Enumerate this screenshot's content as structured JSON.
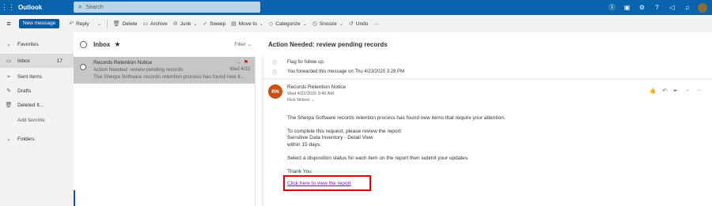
{
  "topbar": {
    "app_name": "Outlook",
    "search_placeholder": "Search",
    "icons": [
      "skype-icon",
      "teams-icon",
      "settings-icon",
      "help-icon",
      "megaphone-icon",
      "bell-icon"
    ]
  },
  "commands": {
    "new_message": "New message",
    "reply": "Reply",
    "delete": "Delete",
    "archive": "Archive",
    "junk": "Junk",
    "sweep": "Sweep",
    "move_to": "Move to",
    "categorize": "Categorize",
    "snooze": "Snooze",
    "undo": "Undo",
    "more": "···"
  },
  "nav": {
    "favorites": "Favorites",
    "inbox": "Inbox",
    "inbox_count": "17",
    "sent_items": "Sent Items",
    "drafts": "Drafts",
    "deleted": "Deleted It...",
    "add_favorite": "Add favorite",
    "folders": "Folders"
  },
  "list": {
    "title": "Inbox",
    "filter": "Filter",
    "message": {
      "sender": "Records Retention Notice",
      "subject": "Action Needed: review pending records",
      "preview": "The Sherpa Software records retention process has found new it...",
      "date": "Wed 4/22"
    }
  },
  "reading": {
    "subject": "Action Needed: review pending records",
    "flag_note": "Flag for follow up.",
    "forward_note": "You forwarded this message on Thu 4/23/2020 3:28 PM",
    "initials": "RN",
    "from": "Records Retention Notice",
    "sent": "Wed 4/22/2020 9:40 AM",
    "to": "Rick Wilson",
    "body": {
      "line1": "The Sherpa Software records retention process has found new items that require your attention.",
      "line2": "To complete this request, please review the report:",
      "line3": "Sensitive Data Inventory - Detail View",
      "line4": "within 15 days.",
      "line5": "Select a disposition status for each item on the report then submit your updates.",
      "line6": "Thank You",
      "link": "Click here to view the report"
    }
  },
  "colors": {
    "topbar": "#0a64ad",
    "avatar": "#ca5010",
    "highlight_box": "#e00000"
  }
}
